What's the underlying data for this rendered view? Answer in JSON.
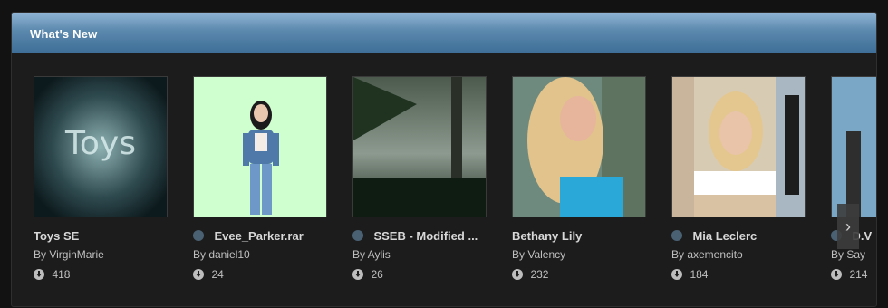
{
  "panel": {
    "title": "What's New"
  },
  "items": [
    {
      "title": "Toys SE",
      "author": "By VirginMarie",
      "downloads": "418",
      "has_dot": false
    },
    {
      "title": "Evee_Parker.rar",
      "author": "By daniel10",
      "downloads": "24",
      "has_dot": true
    },
    {
      "title": "SSEB - Modified ...",
      "author": "By Aylis",
      "downloads": "26",
      "has_dot": true
    },
    {
      "title": "Bethany Lily",
      "author": "By Valency",
      "downloads": "232",
      "has_dot": false
    },
    {
      "title": "Mia Leclerc",
      "author": "By axemencito",
      "downloads": "184",
      "has_dot": true
    },
    {
      "title": "D.V",
      "author": "By Say",
      "downloads": "214",
      "has_dot": true
    }
  ],
  "carousel": {
    "next_label": "›"
  }
}
